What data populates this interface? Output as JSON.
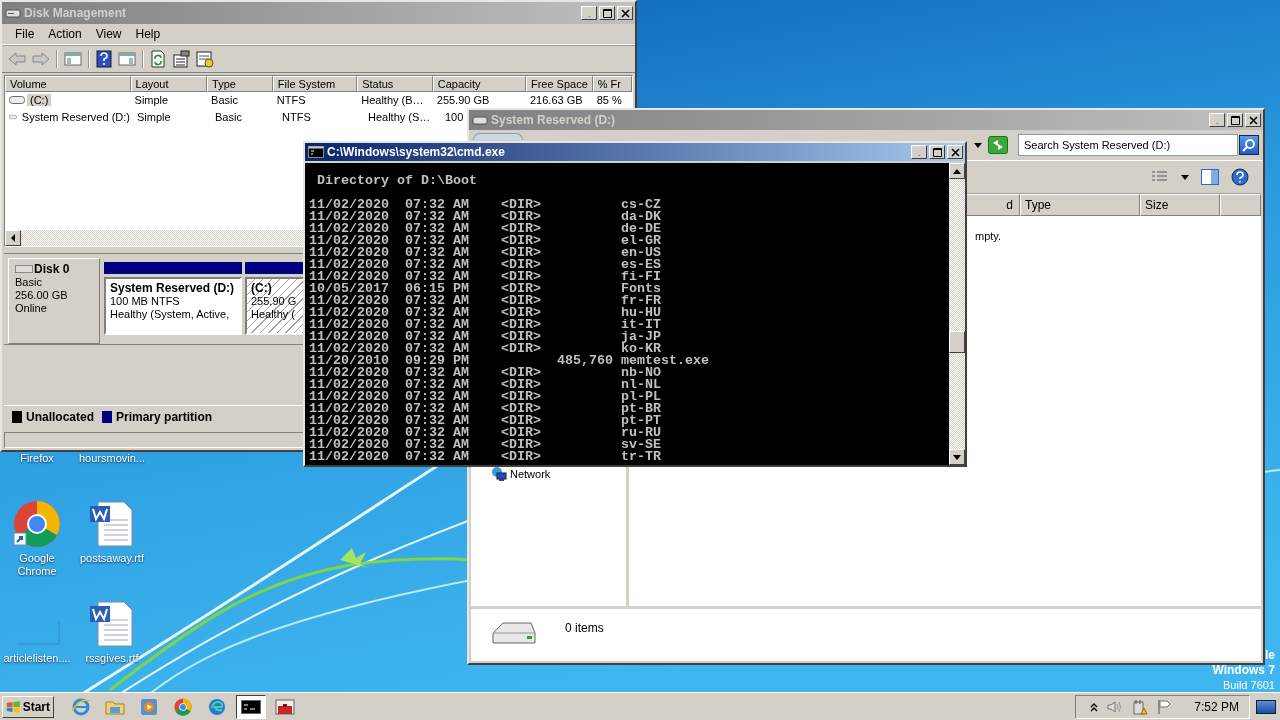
{
  "disk_management": {
    "window": {
      "title": "Disk Management",
      "active": false
    },
    "menu": [
      "File",
      "Action",
      "View",
      "Help"
    ],
    "volumes": {
      "columns": [
        "Volume",
        "Layout",
        "Type",
        "File System",
        "Status",
        "Capacity",
        "Free Space",
        "% Fr"
      ],
      "rows": [
        {
          "cells": [
            "(C:)",
            "Simple",
            "Basic",
            "NTFS",
            "Healthy (B…",
            "255.90 GB",
            "216.63 GB",
            "85 %"
          ],
          "selected": true
        },
        {
          "cells": [
            "System Reserved (D:)",
            "Simple",
            "Basic",
            "NTFS",
            "Healthy (S…",
            "100"
          ],
          "selected": false
        }
      ]
    },
    "disk": {
      "name": "Disk 0",
      "type": "Basic",
      "size": "256.00 GB",
      "status": "Online"
    },
    "partitions": [
      {
        "name": "System Reserved  (D:)",
        "size": "100 MB NTFS",
        "status": "Healthy (System, Active,",
        "selected": false
      },
      {
        "name": "(C:)",
        "size": "255.90 G",
        "status": "Healthy (",
        "selected": true
      }
    ],
    "legend": [
      {
        "label": "Unallocated",
        "color": "#000000"
      },
      {
        "label": "Primary partition",
        "color": "#000080"
      }
    ]
  },
  "explorer": {
    "window": {
      "title": "System Reserved (D:)",
      "active": false
    },
    "search": {
      "placeholder": "Search System Reserved (D:)"
    },
    "columns": [
      "d",
      "Type",
      "Size"
    ],
    "empty_text": "mpty.",
    "navigation": [
      {
        "label": "Network"
      }
    ],
    "details": {
      "count": "0 items"
    }
  },
  "cmd": {
    "window": {
      "title": "C:\\Windows\\system32\\cmd.exe",
      "active": true
    },
    "heading": " Directory of D:\\Boot",
    "lines": [
      "11/02/2020  07:32 AM    <DIR>          cs-CZ",
      "11/02/2020  07:32 AM    <DIR>          da-DK",
      "11/02/2020  07:32 AM    <DIR>          de-DE",
      "11/02/2020  07:32 AM    <DIR>          el-GR",
      "11/02/2020  07:32 AM    <DIR>          en-US",
      "11/02/2020  07:32 AM    <DIR>          es-ES",
      "11/02/2020  07:32 AM    <DIR>          fi-FI",
      "10/05/2017  06:15 PM    <DIR>          Fonts",
      "11/02/2020  07:32 AM    <DIR>          fr-FR",
      "11/02/2020  07:32 AM    <DIR>          hu-HU",
      "11/02/2020  07:32 AM    <DIR>          it-IT",
      "11/02/2020  07:32 AM    <DIR>          ja-JP",
      "11/02/2020  07:32 AM    <DIR>          ko-KR",
      "11/20/2010  09:29 PM           485,760 memtest.exe",
      "11/02/2020  07:32 AM    <DIR>          nb-NO",
      "11/02/2020  07:32 AM    <DIR>          nl-NL",
      "11/02/2020  07:32 AM    <DIR>          pl-PL",
      "11/02/2020  07:32 AM    <DIR>          pt-BR",
      "11/02/2020  07:32 AM    <DIR>          pt-PT",
      "11/02/2020  07:32 AM    <DIR>          ru-RU",
      "11/02/2020  07:32 AM    <DIR>          sv-SE",
      "11/02/2020  07:32 AM    <DIR>          tr-TR"
    ]
  },
  "desktop_icons": [
    {
      "label": "Firefox",
      "kind": "hidden"
    },
    {
      "label": "hoursmovin...",
      "kind": "hidden"
    },
    {
      "label": "Google Chrome",
      "kind": "chrome"
    },
    {
      "label": "postsaway.rtf",
      "kind": "word"
    },
    {
      "label": "articlelisten....",
      "kind": "blank"
    },
    {
      "label": "rssgives.rtf",
      "kind": "word"
    }
  ],
  "desktop_text": [
    "le",
    "Windows 7",
    "Build 7601"
  ],
  "taskbar": {
    "start": "Start",
    "buttons": [
      {
        "kind": "ie",
        "selected": false
      },
      {
        "kind": "folder",
        "selected": false
      },
      {
        "kind": "media",
        "selected": false
      },
      {
        "kind": "chrome",
        "selected": false
      },
      {
        "kind": "edge",
        "selected": false
      },
      {
        "kind": "cmd",
        "selected": true
      },
      {
        "kind": "toolbox",
        "selected": false
      }
    ],
    "clock": "7:52 PM"
  }
}
